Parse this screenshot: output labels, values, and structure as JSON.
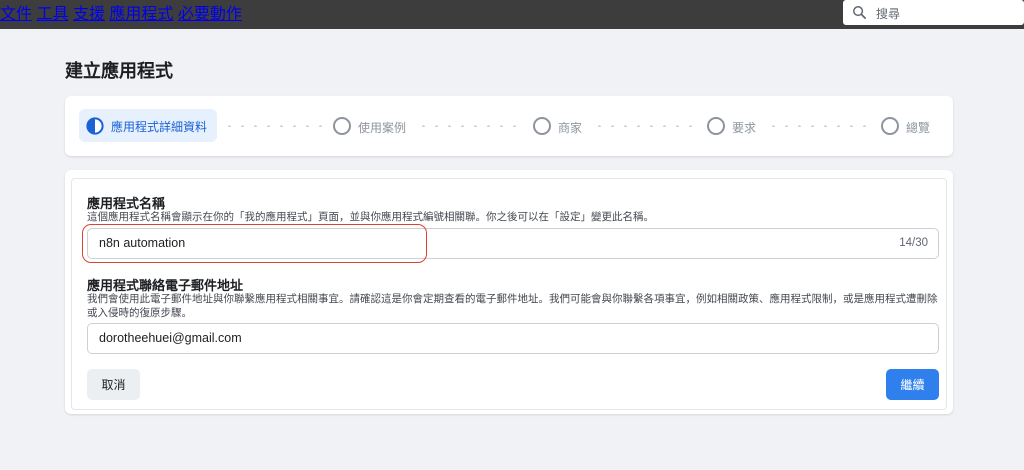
{
  "topbar": {
    "nav": [
      "文件",
      "工具",
      "支援",
      "應用程式",
      "必要動作"
    ],
    "search_placeholder": "搜尋"
  },
  "page_title": "建立應用程式",
  "stepper": {
    "steps": [
      {
        "label": "應用程式詳細資料",
        "state": "active"
      },
      {
        "label": "使用案例",
        "state": "pending"
      },
      {
        "label": "商家",
        "state": "pending"
      },
      {
        "label": "要求",
        "state": "pending"
      },
      {
        "label": "總覽",
        "state": "pending"
      }
    ]
  },
  "form": {
    "app_name": {
      "label": "應用程式名稱",
      "help": "這個應用程式名稱會顯示在你的「我的應用程式」頁面，並與你應用程式編號相關聯。你之後可以在「設定」變更此名稱。",
      "value": "n8n automation",
      "counter": "14/30"
    },
    "contact_email": {
      "label": "應用程式聯絡電子郵件地址",
      "help": "我們會使用此電子郵件地址與你聯繫應用程式相關事宜。請確認這是你會定期查看的電子郵件地址。我們可能會與你聯繫各項事宜，例如相關政策、應用程式限制，或是應用程式遭刪除或入侵時的復原步驟。",
      "value": "dorotheehuei@gmail.com"
    },
    "cancel_label": "取消",
    "continue_label": "繼續"
  },
  "colors": {
    "topbar": "#3d3d3d",
    "accent": "#2f80ed",
    "active_step_bg": "#e7f0fd",
    "highlight": "#d9442f"
  }
}
